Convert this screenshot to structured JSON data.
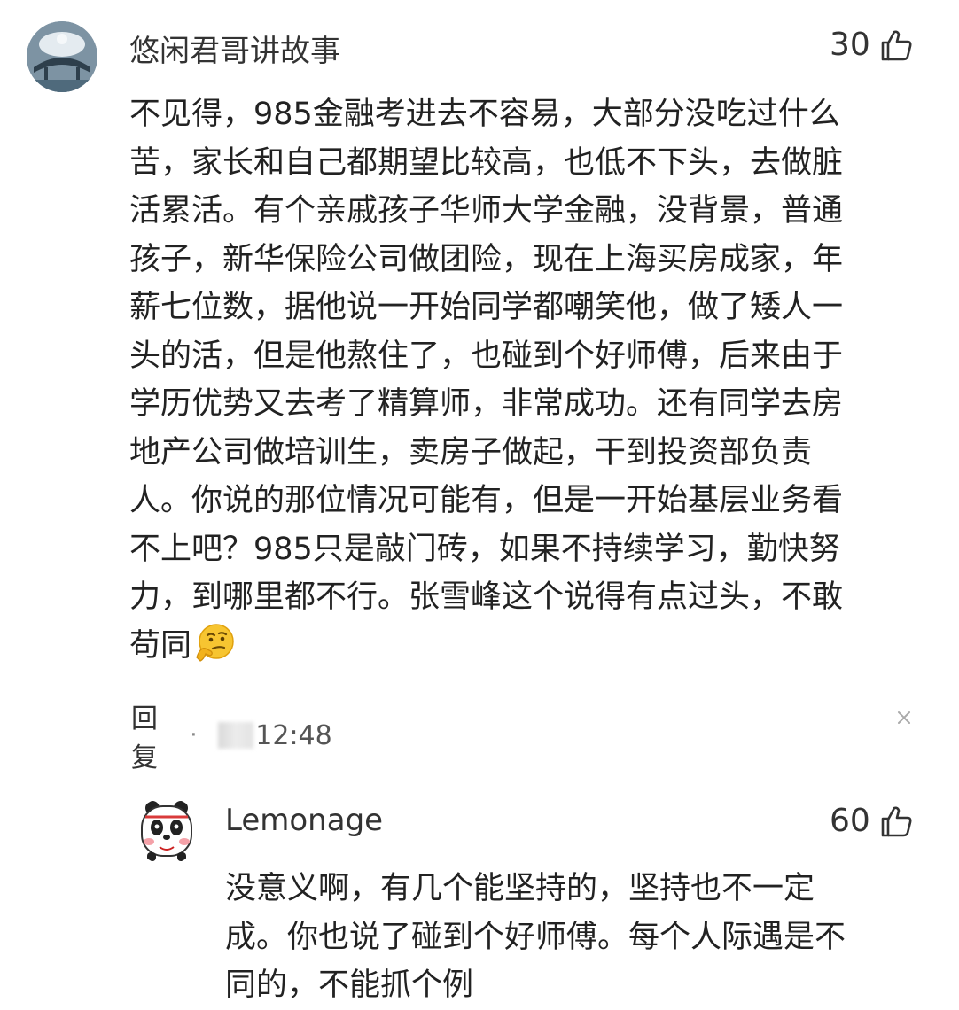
{
  "comment": {
    "username": "悠闲君哥讲故事",
    "likes": "30",
    "lines": [
      "不见得，985金融考进去不容易，大部分没吃过什么",
      "苦，家长和自己都期望比较高，也低不下头，去做脏",
      "活累活。有个亲戚孩子华师大学金融，没背景，普通",
      "孩子，新华保险公司做团险，现在上海买房成家，年",
      "薪七位数，据他说一开始同学都嘲笑他，做了矮人一",
      "头的活，但是他熬住了，也碰到个好师傅，后来由于",
      "学历优势又去考了精算师，非常成功。还有同学去房",
      "地产公司做培训生，卖房子做起，干到投资部负责",
      "人。你说的那位情况可能有，但是一开始基层业务看",
      "不上吧？985只是敲门砖，如果不持续学习，勤快努",
      "力，到哪里都不行。张雪峰这个说得有点过头，不敢",
      "苟同"
    ],
    "emoji_icon": "thinking-face-emoji",
    "reply_label": "回复",
    "dot": "·",
    "time": "12:48"
  },
  "reply": {
    "username": "Lemonage",
    "likes": "60",
    "lines": [
      "没意义啊，有几个能坚持的，坚持也不一定",
      "成。你也说了碰到个好师傅。每个人际遇是不",
      "同的，不能抓个例"
    ]
  },
  "colors": {
    "text": "#222222",
    "meta": "#555555",
    "icon": "#333333"
  }
}
